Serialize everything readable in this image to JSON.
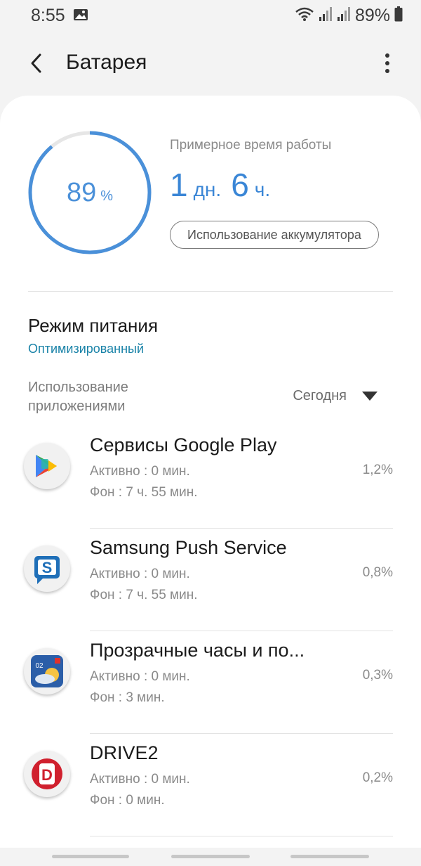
{
  "status_bar": {
    "time": "8:55",
    "battery_text": "89%",
    "icons": [
      "image-icon",
      "wifi-icon",
      "signal-icon",
      "signal-icon-2",
      "battery-icon"
    ]
  },
  "header": {
    "title": "Батарея"
  },
  "battery": {
    "percent": 89,
    "percent_text": "89",
    "percent_unit": "%",
    "estimate_label": "Примерное время работы",
    "estimate_days": "1",
    "estimate_days_unit": "дн.",
    "estimate_hours": "6",
    "estimate_hours_unit": "ч.",
    "usage_button_label": "Использование аккумулятора",
    "accent_color": "#4a90d9"
  },
  "power_mode": {
    "title": "Режим питания",
    "value": "Оптимизированный"
  },
  "app_usage": {
    "heading": "Использование приложениями",
    "period": "Сегодня",
    "apps": [
      {
        "name": "Сервисы Google Play",
        "active": "Активно : 0 мин.",
        "background": "Фон : 7 ч. 55 мин.",
        "percent": "1,2%",
        "icon": "google-play-services-icon"
      },
      {
        "name": "Samsung Push Service",
        "active": "Активно : 0 мин.",
        "background": "Фон : 7 ч. 55 мин.",
        "percent": "0,8%",
        "icon": "samsung-push-icon"
      },
      {
        "name": "Прозрачные часы и по...",
        "active": "Активно : 0 мин.",
        "background": "Фон : 3 мин.",
        "percent": "0,3%",
        "icon": "weather-clock-icon"
      },
      {
        "name": "DRIVE2",
        "active": "Активно : 0 мин.",
        "background": "Фон : 0 мин.",
        "percent": "0,2%",
        "icon": "drive2-icon"
      }
    ]
  }
}
